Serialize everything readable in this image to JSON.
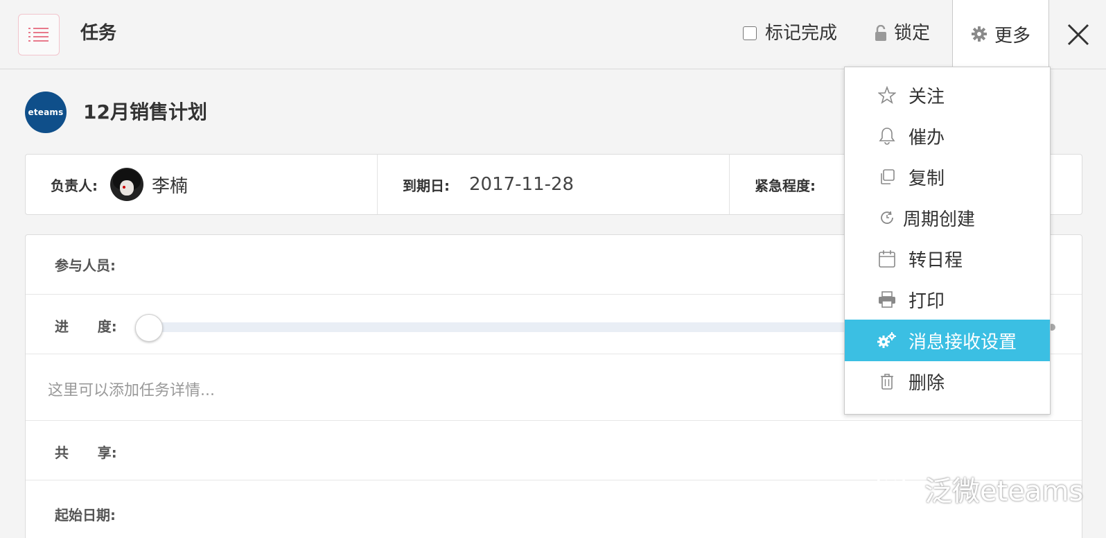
{
  "header": {
    "title": "任务",
    "mark_done_label": "标记完成",
    "lock_label": "锁定",
    "more_label": "更多"
  },
  "task": {
    "logo_text": "eteams",
    "title": "12月销售计划"
  },
  "info": {
    "owner_label": "负责人:",
    "owner_name": "李楠",
    "due_label": "到期日:",
    "due_value": "2017-11-28",
    "urgency_label": "紧急程度:"
  },
  "details": {
    "participants_label": "参与人员:",
    "progress_label": "进      度:",
    "progress_value": 0,
    "description_placeholder": "这里可以添加任务详情...",
    "share_label": "共      享:",
    "start_date_label": "起始日期:"
  },
  "more_menu": {
    "items": [
      {
        "label": "关注",
        "icon": "star-icon"
      },
      {
        "label": "催办",
        "icon": "bell-icon"
      },
      {
        "label": "复制",
        "icon": "copy-icon"
      },
      {
        "label": "周期创建",
        "icon": "cycle-icon"
      },
      {
        "label": "转日程",
        "icon": "calendar-icon"
      },
      {
        "label": "打印",
        "icon": "printer-icon"
      },
      {
        "label": "消息接收设置",
        "icon": "gears-icon",
        "active": true
      },
      {
        "label": "删除",
        "icon": "trash-icon"
      }
    ]
  },
  "watermark": {
    "text": "泛微eteams"
  },
  "colors": {
    "highlight": "#3bbfe3",
    "logo_bg": "#0f4f8a"
  }
}
